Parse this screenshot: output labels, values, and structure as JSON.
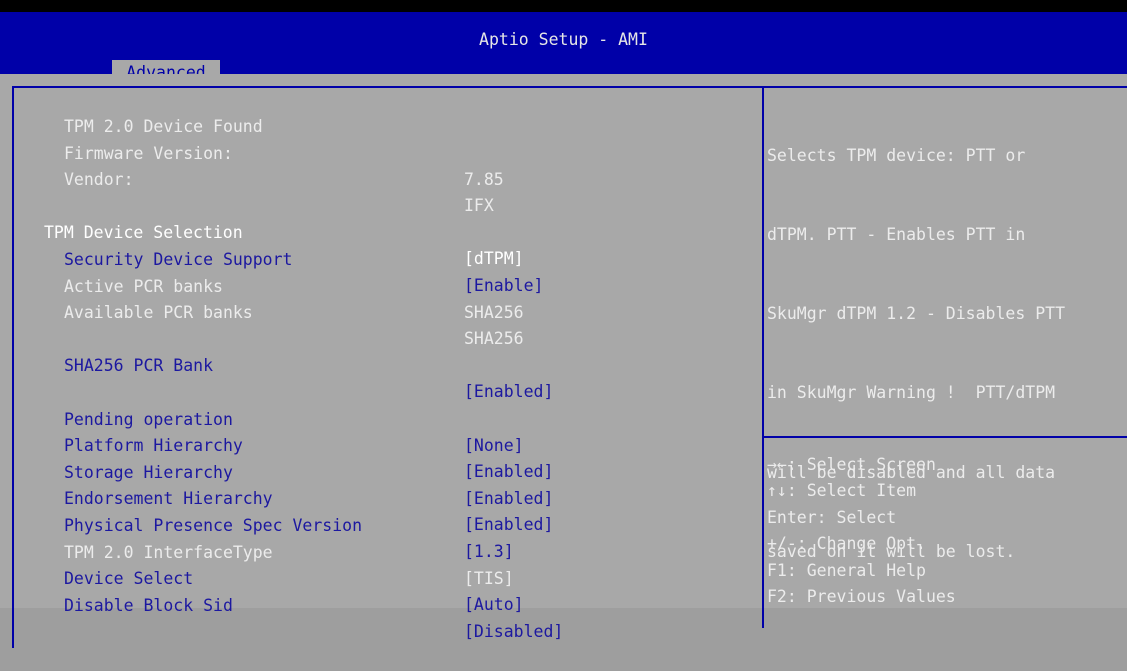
{
  "app_title": "Aptio Setup - AMI",
  "active_tab": "Advanced",
  "settings": [
    {
      "label": "TPM 2.0 Device Found",
      "value": "",
      "style": "gray"
    },
    {
      "label": "Firmware Version:",
      "value": "7.85",
      "style": "gray"
    },
    {
      "label": "Vendor:",
      "value": "IFX",
      "style": "gray"
    },
    {
      "label": "",
      "value": "",
      "style": "gap"
    },
    {
      "label": "TPM Device Selection",
      "value": "[dTPM]",
      "style": "selected"
    },
    {
      "label": "Security Device Support",
      "value": "[Enable]",
      "style": "blue"
    },
    {
      "label": "Active PCR banks",
      "value": "SHA256",
      "style": "gray"
    },
    {
      "label": "Available PCR banks",
      "value": "SHA256",
      "style": "gray"
    },
    {
      "label": "",
      "value": "",
      "style": "gap"
    },
    {
      "label": "SHA256 PCR Bank",
      "value": "[Enabled]",
      "style": "blue"
    },
    {
      "label": "",
      "value": "",
      "style": "gap"
    },
    {
      "label": "Pending operation",
      "value": "[None]",
      "style": "blue"
    },
    {
      "label": "Platform Hierarchy",
      "value": "[Enabled]",
      "style": "blue"
    },
    {
      "label": "Storage Hierarchy",
      "value": "[Enabled]",
      "style": "blue"
    },
    {
      "label": "Endorsement Hierarchy",
      "value": "[Enabled]",
      "style": "blue"
    },
    {
      "label": "Physical Presence Spec Version",
      "value": "[1.3]",
      "style": "blue"
    },
    {
      "label": "TPM 2.0 InterfaceType",
      "value": "[TIS]",
      "style": "gray"
    },
    {
      "label": "Device Select",
      "value": "[Auto]",
      "style": "blue"
    },
    {
      "label": "Disable Block Sid",
      "value": "[Disabled]",
      "style": "blue"
    }
  ],
  "help_lines": [
    "Selects TPM device: PTT or",
    "dTPM. PTT - Enables PTT in",
    "SkuMgr dTPM 1.2 - Disables PTT",
    "in SkuMgr Warning !  PTT/dTPM",
    "will be disabled and all data",
    "saved on it will be lost."
  ],
  "key_help": [
    "→←: Select Screen",
    "↑↓: Select Item",
    "Enter: Select",
    "+/-: Change Opt.",
    "F1: General Help",
    "F2: Previous Values"
  ]
}
